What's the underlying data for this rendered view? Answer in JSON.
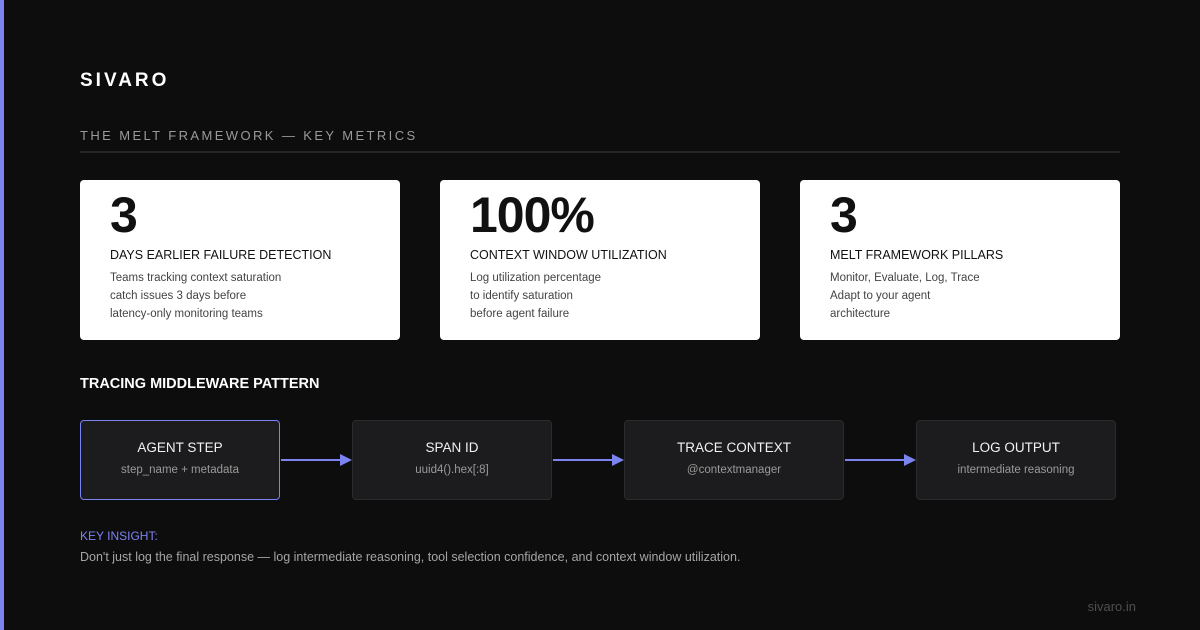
{
  "brand": "SIVARO",
  "section_title": "THE MELT FRAMEWORK — KEY METRICS",
  "accent_color": "#7b83f0",
  "metrics": [
    {
      "value": "3",
      "label": "DAYS EARLIER FAILURE DETECTION",
      "description": [
        "Teams tracking context saturation",
        "catch issues 3 days before",
        "latency-only monitoring teams"
      ]
    },
    {
      "value": "100%",
      "label": "CONTEXT WINDOW UTILIZATION",
      "description": [
        "Log utilization percentage",
        "to identify saturation",
        "before agent failure"
      ]
    },
    {
      "value": "3",
      "label": "MELT FRAMEWORK PILLARS",
      "description": [
        "Monitor, Evaluate, Log, Trace",
        "Adapt to your agent",
        "architecture"
      ]
    }
  ],
  "flow": {
    "title": "TRACING MIDDLEWARE PATTERN",
    "nodes": [
      {
        "title": "AGENT STEP",
        "subtitle": "step_name + metadata"
      },
      {
        "title": "SPAN ID",
        "subtitle": "uuid4().hex[:8]"
      },
      {
        "title": "TRACE CONTEXT",
        "subtitle": "@contextmanager"
      },
      {
        "title": "LOG OUTPUT",
        "subtitle": "intermediate reasoning"
      }
    ]
  },
  "insight": {
    "label": "KEY INSIGHT:",
    "text": "Don't just log the final response — log intermediate reasoning, tool selection confidence, and context window utilization."
  },
  "footer": "sivaro.in"
}
